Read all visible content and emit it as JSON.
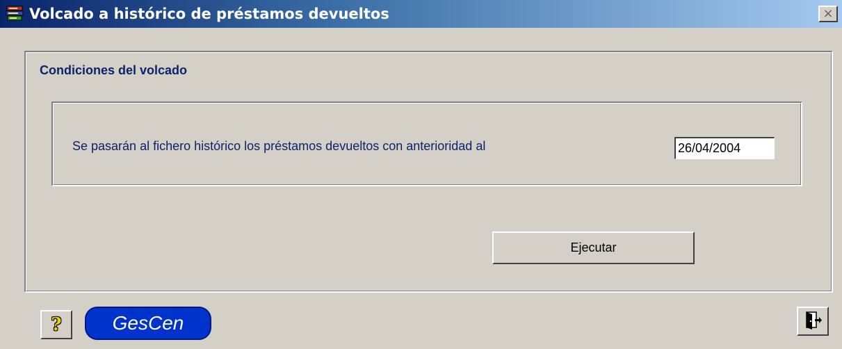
{
  "window": {
    "title": "Volcado a histórico de préstamos devueltos",
    "close_label": "×"
  },
  "conditions": {
    "group_title": "Condiciones del volcado",
    "description": "Se pasarán al  fichero histórico los préstamos devueltos con anterioridad al",
    "date_value": "26/04/2004"
  },
  "actions": {
    "execute_label": "Ejecutar",
    "help_glyph": "?",
    "logo_text": "GesCen"
  },
  "icons": {
    "app": "books-icon",
    "help": "question-mark-icon",
    "exit": "door-exit-icon"
  },
  "colors": {
    "title_gradient_start": "#0a246a",
    "title_gradient_end": "#a6caf0",
    "label_text": "#0a246a",
    "window_background": "#d4d0c8",
    "logo_background": "#0033cc"
  }
}
